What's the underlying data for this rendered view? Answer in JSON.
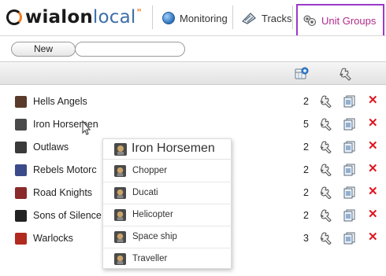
{
  "brand": {
    "logo_text_a": "wialon",
    "logo_text_b": "local",
    "logo_mark": "\""
  },
  "nav": {
    "items": [
      {
        "label": "Monitoring",
        "icon": "globe-icon"
      },
      {
        "label": "Tracks",
        "icon": "tracks-icon"
      },
      {
        "label": "Unit Groups",
        "icon": "unit-groups-icon"
      }
    ],
    "active_index": 2,
    "accent": "#9a3ac8"
  },
  "toolbar": {
    "new_label": "New",
    "search_value": ""
  },
  "table": {
    "rows": [
      {
        "name": "Hells Angels",
        "count": "2",
        "icon_color": "#5a3a2a"
      },
      {
        "name": "Iron Horsemen",
        "count": "5",
        "icon_color": "#4a4a4a"
      },
      {
        "name": "Outlaws",
        "count": "2",
        "icon_color": "#3a3a3a"
      },
      {
        "name": "Rebels Motorc",
        "count": "2",
        "icon_color": "#3b4a88"
      },
      {
        "name": "Road Knights",
        "count": "2",
        "icon_color": "#8a2a2a"
      },
      {
        "name": "Sons of Silence",
        "count": "2",
        "icon_color": "#222222"
      },
      {
        "name": "Warlocks",
        "count": "3",
        "icon_color": "#b02a1e"
      }
    ],
    "delete_glyph": "✕",
    "delete_color": "#e0141e"
  },
  "popup": {
    "title": "Iron Horsemen",
    "items": [
      "Chopper",
      "Ducati",
      "Helicopter",
      "Space ship",
      "Traveller"
    ]
  }
}
